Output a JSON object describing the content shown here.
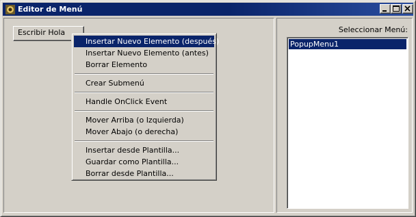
{
  "window": {
    "title": "Editor de Menú",
    "icon": "delphi-app-icon"
  },
  "left": {
    "button_label": "Escribir Hola"
  },
  "right": {
    "label": "Seleccionar Menú:",
    "list_items": [
      "PopupMenu1"
    ]
  },
  "context_menu": {
    "items": [
      "Insertar Nuevo Elemento (después)",
      "Insertar Nuevo Elemento (antes)",
      "Borrar Elemento",
      "Crear Submenú",
      "Handle OnClick Event",
      "Mover Arriba (o Izquierda)",
      "Mover Abajo (o derecha)",
      "Insertar desde Plantilla...",
      "Guardar como Plantilla...",
      "Borrar desde Plantilla..."
    ],
    "highlighted_index": 0
  },
  "colors": {
    "titlebar": "#0a246a",
    "face": "#d4d0c8",
    "selection": "#0a246a"
  }
}
